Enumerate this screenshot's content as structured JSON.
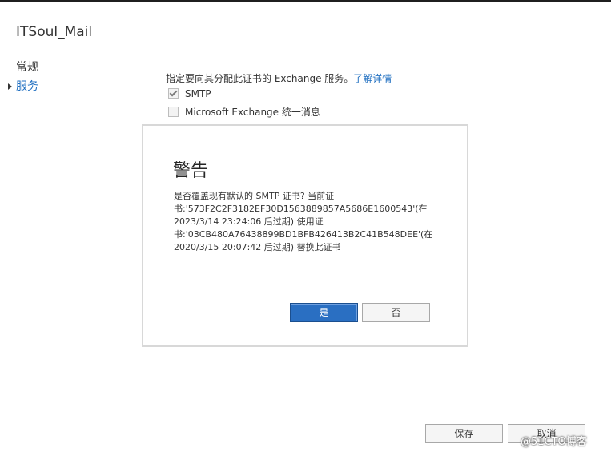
{
  "window": {
    "title": "ITSoul_Mail"
  },
  "nav": {
    "items": [
      {
        "label": "常规"
      },
      {
        "label": "服务"
      }
    ]
  },
  "services": {
    "instruction": "指定要向其分配此证书的 Exchange 服务。",
    "learn_more": "了解详情",
    "items": [
      {
        "label": "SMTP",
        "checked": true
      },
      {
        "label": "Microsoft Exchange 统一消息",
        "checked": false
      }
    ]
  },
  "dialog": {
    "title": "警告",
    "message_lines": [
      "是否覆盖现有默认的 SMTP 证书? 当前证",
      "书:'573F2C2F3182EF30D1563889857A5686E1600543'(在",
      "2023/3/14 23:24:06 后过期) 使用证",
      "书:'03CB480A76438899BD1BFB426413B2C41B548DEE'(在",
      "2020/3/15 20:07:42 后过期) 替换此证书"
    ],
    "yes_label": "是",
    "no_label": "否"
  },
  "footer": {
    "save_label": "保存",
    "cancel_label": "取消"
  },
  "watermark": "@51CTO博客",
  "colors": {
    "accent": "#2a6fc2",
    "link": "#1e6ec0"
  }
}
